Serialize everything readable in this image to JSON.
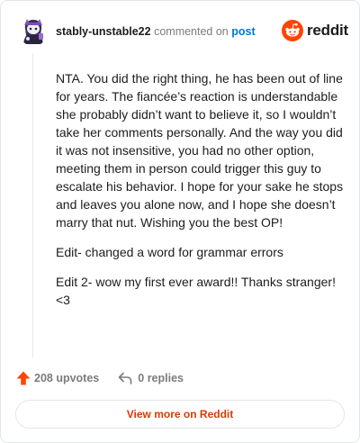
{
  "header": {
    "username": "stably-unstable22",
    "verb": "commented on",
    "post_link": "post",
    "logo_text": "reddit"
  },
  "comment": {
    "paragraphs": [
      "NTA. You did the right thing, he has been out of line for years. The fiancée’s reaction is understandable she probably didn’t want to believe it, so I wouldn’t take her comments personally. And the way you did it was not insensitive, you had no other option, meeting them in person could trigger this guy to escalate his behavior. I hope for your sake he stops and leaves you alone now, and I hope she doesn’t marry that nut. Wishing you the best OP!",
      "Edit- changed a word for grammar errors",
      "Edit 2- wow my first ever award!! Thanks stranger! <3"
    ]
  },
  "actions": {
    "upvotes_label": "208 upvotes",
    "replies_label": "0 replies"
  },
  "footer": {
    "view_more_label": "View more on Reddit"
  },
  "colors": {
    "brand": "#ff4500",
    "link": "#0079d3",
    "view_more": "#d93a00",
    "muted": "#7c7c7c"
  },
  "icons": {
    "avatar": "snoo-avatar",
    "logo": "reddit-snoo-icon",
    "upvote": "upvote-arrow-icon",
    "reply": "reply-arrow-icon"
  }
}
